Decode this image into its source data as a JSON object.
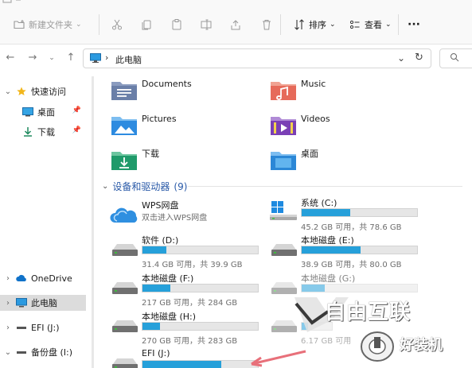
{
  "toolbar": {
    "new_folder_label": "新建文件夹",
    "sort_label": "排序",
    "view_label": "查看",
    "more_label": "···"
  },
  "address": {
    "path": "此电脑",
    "separator": "›",
    "search_icon": "search-icon"
  },
  "nav": {
    "quick_access": "快速访问",
    "desktop": "桌面",
    "downloads": "下载",
    "onedrive": "OneDrive",
    "this_pc": "此电脑",
    "efi": "EFI (J:)",
    "backup": "备份盘 (I:)"
  },
  "folders": [
    {
      "name": "Documents",
      "icon": "documents-folder-icon",
      "color": "#6a7fa8"
    },
    {
      "name": "Music",
      "icon": "music-folder-icon",
      "color": "#e66a5a"
    },
    {
      "name": "Pictures",
      "icon": "pictures-folder-icon",
      "color": "#2d8be0"
    },
    {
      "name": "Videos",
      "icon": "videos-folder-icon",
      "color": "#7a3fb5"
    },
    {
      "name": "下载",
      "icon": "downloads-folder-icon",
      "color": "#1f9a6a"
    },
    {
      "name": "桌面",
      "icon": "desktop-folder-icon",
      "color": "#2b87d6"
    }
  ],
  "devices_section": {
    "title": "设备和驱动器",
    "count": "(9)"
  },
  "drives": [
    {
      "name": "WPS网盘",
      "subtitle": "双击进入WPS网盘",
      "type": "cloud"
    },
    {
      "name": "系统 (C:)",
      "size": "45.2 GB 可用，共 78.6 GB",
      "used": 0.42
    },
    {
      "name": "软件 (D:)",
      "size": "31.4 GB 可用，共 39.9 GB",
      "used": 0.21
    },
    {
      "name": "本地磁盘 (E:)",
      "size": "38.9 GB 可用，共 80.0 GB",
      "used": 0.51
    },
    {
      "name": "本地磁盘 (F:)",
      "size": "217 GB 可用，共 284 GB",
      "used": 0.24
    },
    {
      "name": "本地磁盘 (G:)",
      "size": "",
      "used": 0.2
    },
    {
      "name": "本地磁盘 (H:)",
      "size": "270 GB 可用，共 283 GB",
      "used": 0.15
    },
    {
      "name": "",
      "size": "6.17 GB 可用",
      "used": 0.2
    },
    {
      "name": "EFI (J:)",
      "size": "",
      "used": 0.68
    }
  ],
  "watermark": {
    "line1": "自由互联",
    "line2": "好装机"
  },
  "colors": {
    "accent": "#26a0da",
    "selection": "#dcdcdc",
    "section_text": "#2a5aa8"
  }
}
